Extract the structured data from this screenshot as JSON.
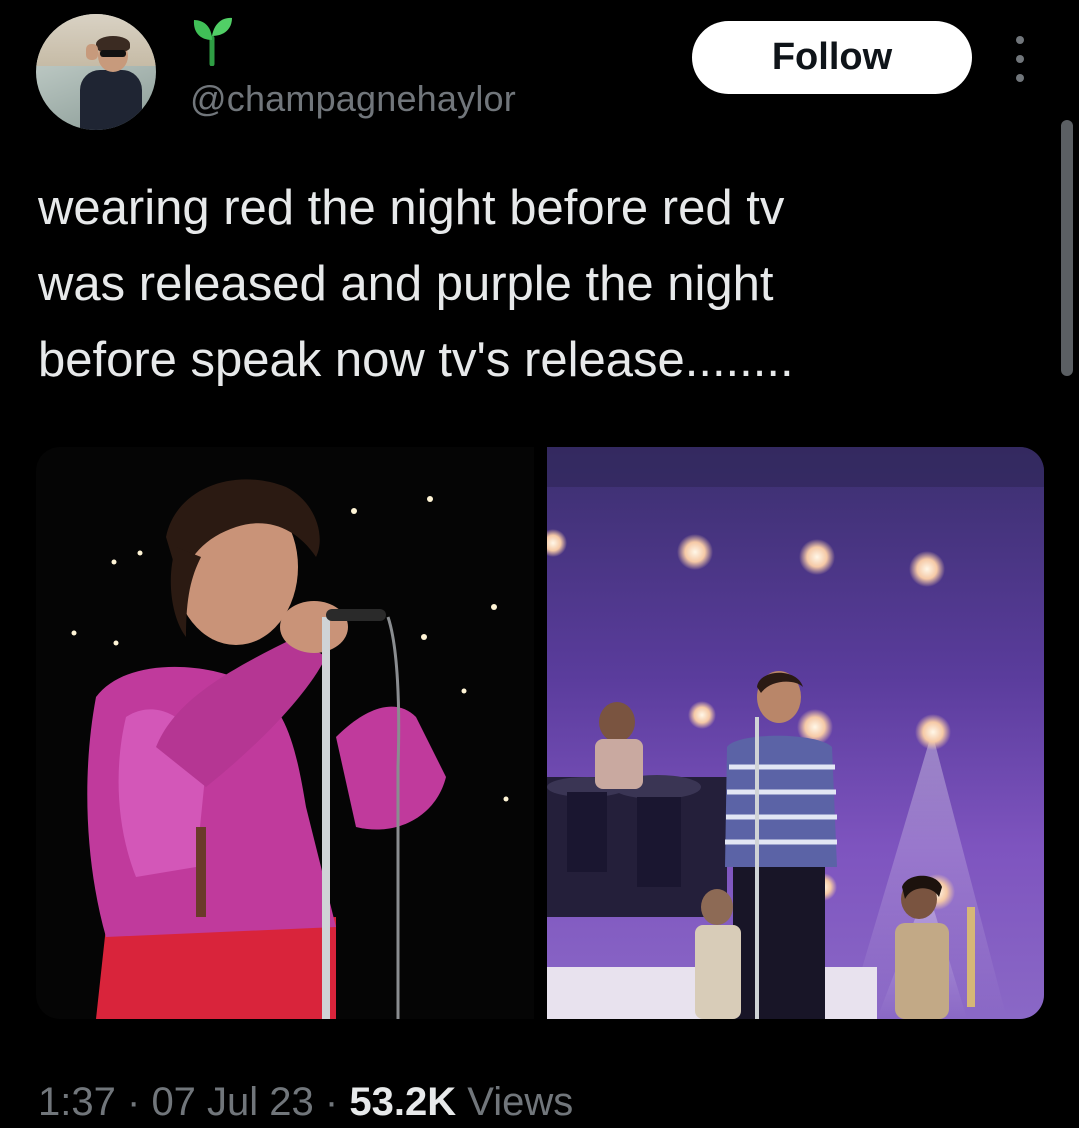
{
  "author": {
    "handle": "@champagnehaylor",
    "avatar_icon": "profile-photo",
    "badge_icon": "seedling-emoji"
  },
  "header": {
    "follow_label": "Follow",
    "more_icon": "more-dots-vertical-icon"
  },
  "tweet": {
    "text": "wearing red the night before red tv\nwas released and purple the night\nbefore speak now tv's release........"
  },
  "media": {
    "photos": [
      {
        "subject": "singer in pink sequin shirt at microphone"
      },
      {
        "subject": "singer on purple-lit stage with band"
      }
    ]
  },
  "meta": {
    "time": "1:37",
    "date": "07 Jul 23",
    "views_count": "53.2K",
    "views_label": "Views",
    "separator": "·"
  },
  "colors": {
    "background": "#000000",
    "text_primary": "#e7e9ea",
    "text_secondary": "#71767b",
    "follow_bg": "#ffffff",
    "follow_text": "#0f1419"
  }
}
